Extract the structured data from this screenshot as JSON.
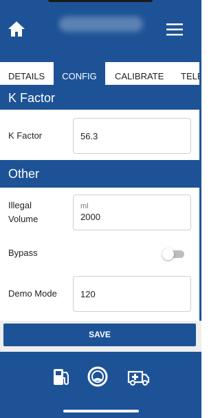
{
  "header": {
    "home_icon": "home-icon",
    "menu_icon": "hamburger-menu-icon"
  },
  "tabs": [
    {
      "label": "DETAILS",
      "active": false
    },
    {
      "label": "CONFIG",
      "active": true
    },
    {
      "label": "CALIBRATE",
      "active": false
    },
    {
      "label": "TELE",
      "active": false
    }
  ],
  "sections": {
    "k_factor": {
      "title": "K Factor",
      "field_label": "K Factor",
      "field_value": "56.3"
    },
    "other": {
      "title": "Other",
      "illegal_volume_label": "Illegal Volume",
      "illegal_volume_unit": "ml",
      "illegal_volume_value": "2000",
      "bypass_label": "Bypass",
      "bypass_on": false,
      "demo_mode_label": "Demo Mode",
      "demo_mode_value": "120"
    }
  },
  "actions": {
    "save_label": "SAVE"
  },
  "bottom_nav": {
    "icons": [
      "fuel-pump-icon",
      "gauge-icon",
      "ambulance-icon"
    ]
  },
  "colors": {
    "primary": "#1d5396",
    "background": "#ffffff",
    "save_band": "#eeeeee"
  }
}
